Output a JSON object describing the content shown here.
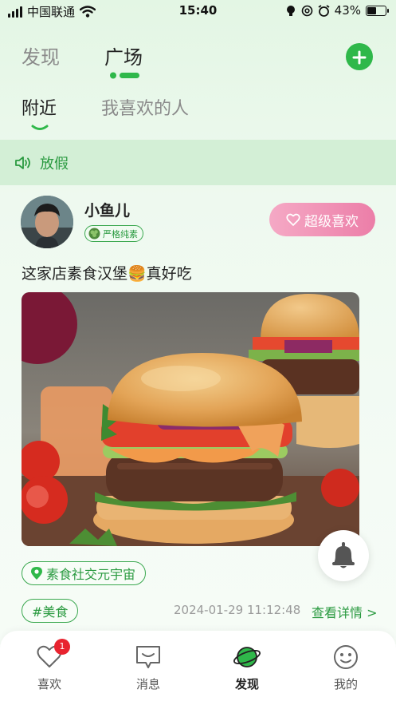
{
  "status_bar": {
    "carrier": "中国联通",
    "time": "15:40",
    "battery": "43%"
  },
  "top_tabs": [
    {
      "label": "发现"
    },
    {
      "label": "广场"
    }
  ],
  "sub_tabs": [
    {
      "label": "附近"
    },
    {
      "label": "我喜欢的人"
    }
  ],
  "notice": {
    "text": "放假"
  },
  "post": {
    "username": "小鱼儿",
    "tag": "严格纯素",
    "super_like_label": "超级喜欢",
    "text": "这家店素食汉堡🍔真好吃",
    "location": "素食社交元宇宙",
    "topic": "#美食",
    "timestamp": "2024-01-29 11:12:48",
    "detail_link": "查看详情 >"
  },
  "bottom_nav": [
    {
      "label": "喜欢",
      "badge": "1",
      "icon": "heart-icon"
    },
    {
      "label": "消息",
      "icon": "message-icon"
    },
    {
      "label": "发现",
      "icon": "planet-icon"
    },
    {
      "label": "我的",
      "icon": "smiley-icon"
    }
  ],
  "colors": {
    "accent": "#2fb84a",
    "super_like": "#ec7ea8",
    "badge": "#e8232f"
  }
}
